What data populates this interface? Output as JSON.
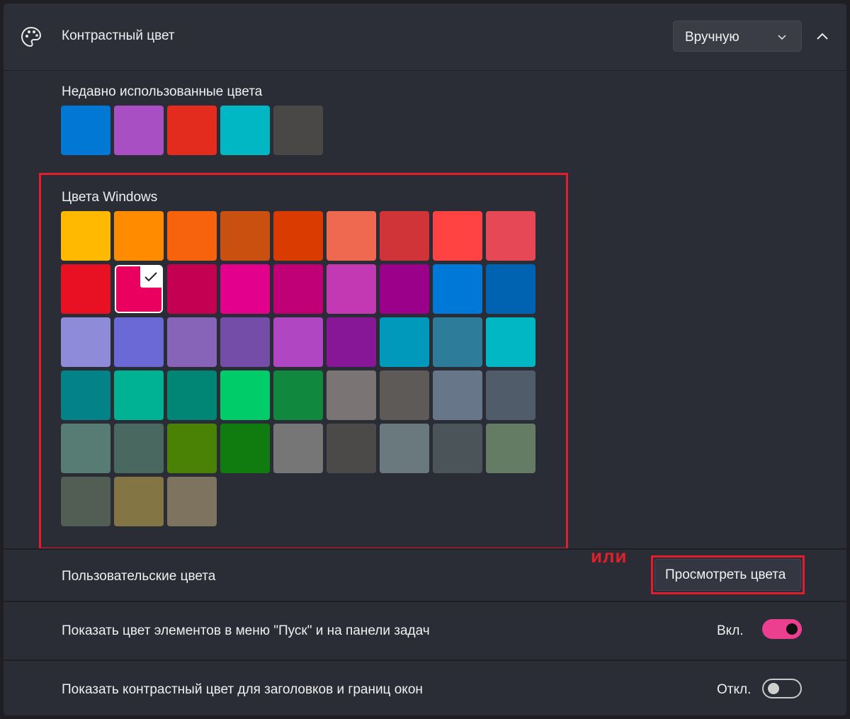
{
  "header": {
    "title": "Контрастный цвет",
    "icon": "palette-icon",
    "dropdown": {
      "selected": "Вручную"
    }
  },
  "recent": {
    "label": "Недавно использованные цвета",
    "colors": [
      "#0078d4",
      "#a94fc4",
      "#e32b1e",
      "#00b7c3",
      "#4a4847"
    ]
  },
  "windows_colors": {
    "label": "Цвета Windows",
    "selected_index": 10,
    "colors": [
      "#ffb900",
      "#ff8c00",
      "#f7630c",
      "#ca5010",
      "#da3b01",
      "#ef6950",
      "#d13438",
      "#ff4343",
      "#e74856",
      "#e81123",
      "#ea005e",
      "#c30052",
      "#e3008c",
      "#bf0077",
      "#c239b3",
      "#9a0089",
      "#0078d7",
      "#0063b1",
      "#8e8cd8",
      "#6b69d6",
      "#8764b8",
      "#744da9",
      "#b146c2",
      "#881798",
      "#0099bc",
      "#2d7d9a",
      "#00b7c3",
      "#038387",
      "#00b294",
      "#018574",
      "#00cc6a",
      "#10893e",
      "#7a7574",
      "#5d5a58",
      "#68768a",
      "#515c6b",
      "#567c73",
      "#486860",
      "#498205",
      "#107c10",
      "#767676",
      "#4c4a48",
      "#69797e",
      "#4a5459",
      "#647c64",
      "#525e54",
      "#847545",
      "#7e735f"
    ]
  },
  "annotation": {
    "or_text": "или"
  },
  "custom_colors": {
    "label": "Пользовательские цвета",
    "button_label": "Просмотреть цвета"
  },
  "start_taskbar": {
    "label": "Показать цвет элементов в меню \"Пуск\" и на панели задач",
    "state": "Вкл.",
    "on": true
  },
  "title_bars": {
    "label": "Показать контрастный цвет для заголовков и границ окон",
    "state": "Откл.",
    "on": false
  },
  "accent": {
    "highlight_red": "#e11d2e",
    "toggle_on": "#ec3f8f"
  }
}
